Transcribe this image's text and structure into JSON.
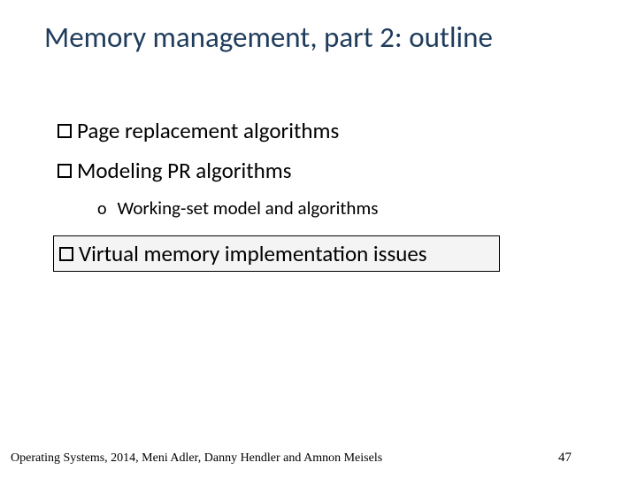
{
  "title": "Memory management, part 2: outline",
  "items": [
    {
      "label": "Page replacement algorithms"
    },
    {
      "label": "Modeling PR algorithms"
    }
  ],
  "sub": {
    "marker": "o",
    "label": "Working-set model and algorithms"
  },
  "boxed": {
    "label": "Virtual memory implementation issues"
  },
  "footer": {
    "left": "Operating Systems, 2014, Meni Adler, Danny Hendler and Amnon Meisels",
    "page": "47"
  }
}
